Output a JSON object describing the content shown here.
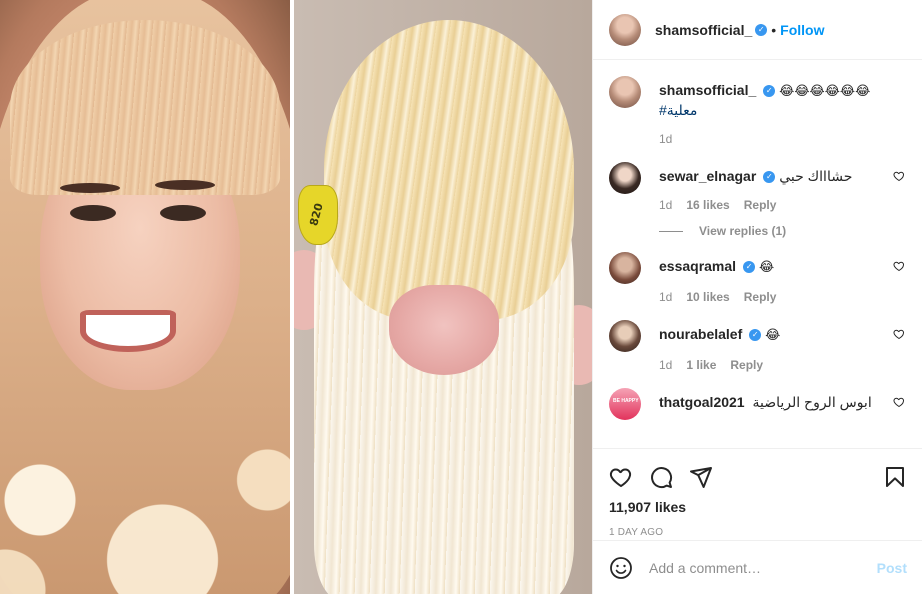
{
  "post": {
    "author": "shamsofficial_",
    "follow_label": "Follow",
    "separator": "•"
  },
  "caption": {
    "username": "shamsofficial_",
    "emojis": "😂😂😂😂😂😂",
    "hashtag": "#معلية",
    "time": "1d"
  },
  "comments": [
    {
      "username": "sewar_elnagar",
      "verified": true,
      "text": "حشاااك حبي",
      "time": "1d",
      "likes": "16 likes",
      "reply": "Reply",
      "view_replies": "View replies (1)"
    },
    {
      "username": "essaqramal",
      "verified": true,
      "text": "😂",
      "time": "1d",
      "likes": "10 likes",
      "reply": "Reply"
    },
    {
      "username": "nourabelalef",
      "verified": true,
      "text": "😂",
      "time": "1d",
      "likes": "1 like",
      "reply": "Reply"
    },
    {
      "username": "thatgoal2021",
      "verified": false,
      "text": "ابوس الروح الرياضية"
    }
  ],
  "stats": {
    "likes": "11,907 likes",
    "date": "1 DAY AGO"
  },
  "add_comment": {
    "placeholder": "Add a comment…",
    "post_label": "Post"
  },
  "media": {
    "ear_tag_text": "820"
  },
  "colors": {
    "accent": "#0095f6",
    "verified": "#3897f0",
    "muted": "#8e8e8e",
    "post_disabled": "#b2dffc"
  },
  "icons": [
    "heart-icon",
    "comment-icon",
    "share-icon",
    "bookmark-icon",
    "smile-icon",
    "verified-icon"
  ]
}
